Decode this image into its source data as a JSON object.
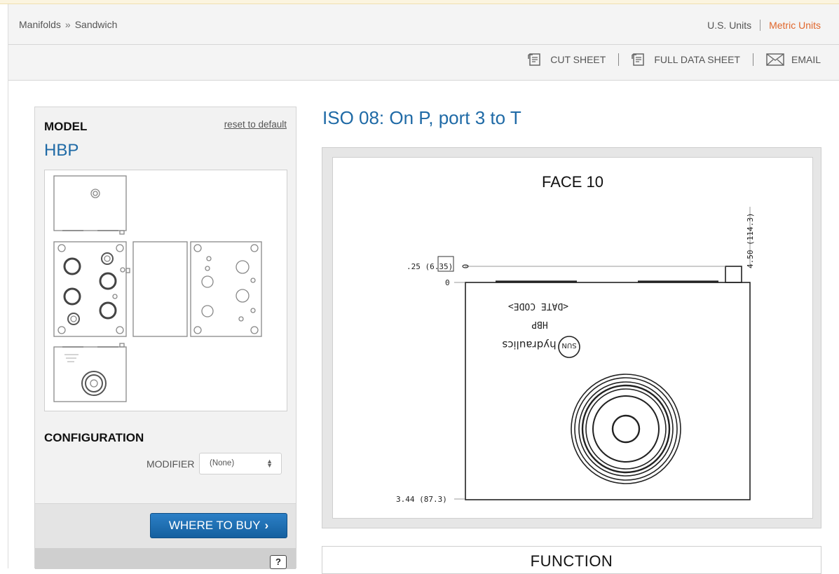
{
  "breadcrumb": {
    "items": [
      "Manifolds",
      "Sandwich"
    ],
    "separator": "»"
  },
  "units": {
    "us": "U.S. Units",
    "metric": "Metric Units"
  },
  "actions": {
    "cut_sheet": "CUT SHEET",
    "full_data_sheet": "FULL DATA SHEET",
    "email": "EMAIL"
  },
  "sidebar": {
    "model_title": "MODEL",
    "reset_link": "reset to default",
    "model_name": "HBP",
    "config_title": "CONFIGURATION",
    "modifier_label": "MODIFIER",
    "modifier_value": "(None)",
    "where_to_buy": "WHERE TO BUY",
    "help": "?"
  },
  "main": {
    "title": "ISO 08: On P, port 3 to T",
    "drawing": {
      "face_label": "FACE 10",
      "dim_top": ".25 (6.35)",
      "dim_right": "4.50 (114.3)",
      "dim_zero": "0",
      "dim_bottom": "3.44 (87.3)",
      "marking_line1": "<DATE CODE>",
      "marking_line2": "HBP",
      "marking_line3": "hydraulics",
      "logo": "SUN"
    },
    "function_title": "FUNCTION"
  },
  "colors": {
    "link_blue": "#1f6aa6",
    "accent_orange": "#e0662b",
    "button_blue": "#1d6fb3"
  }
}
